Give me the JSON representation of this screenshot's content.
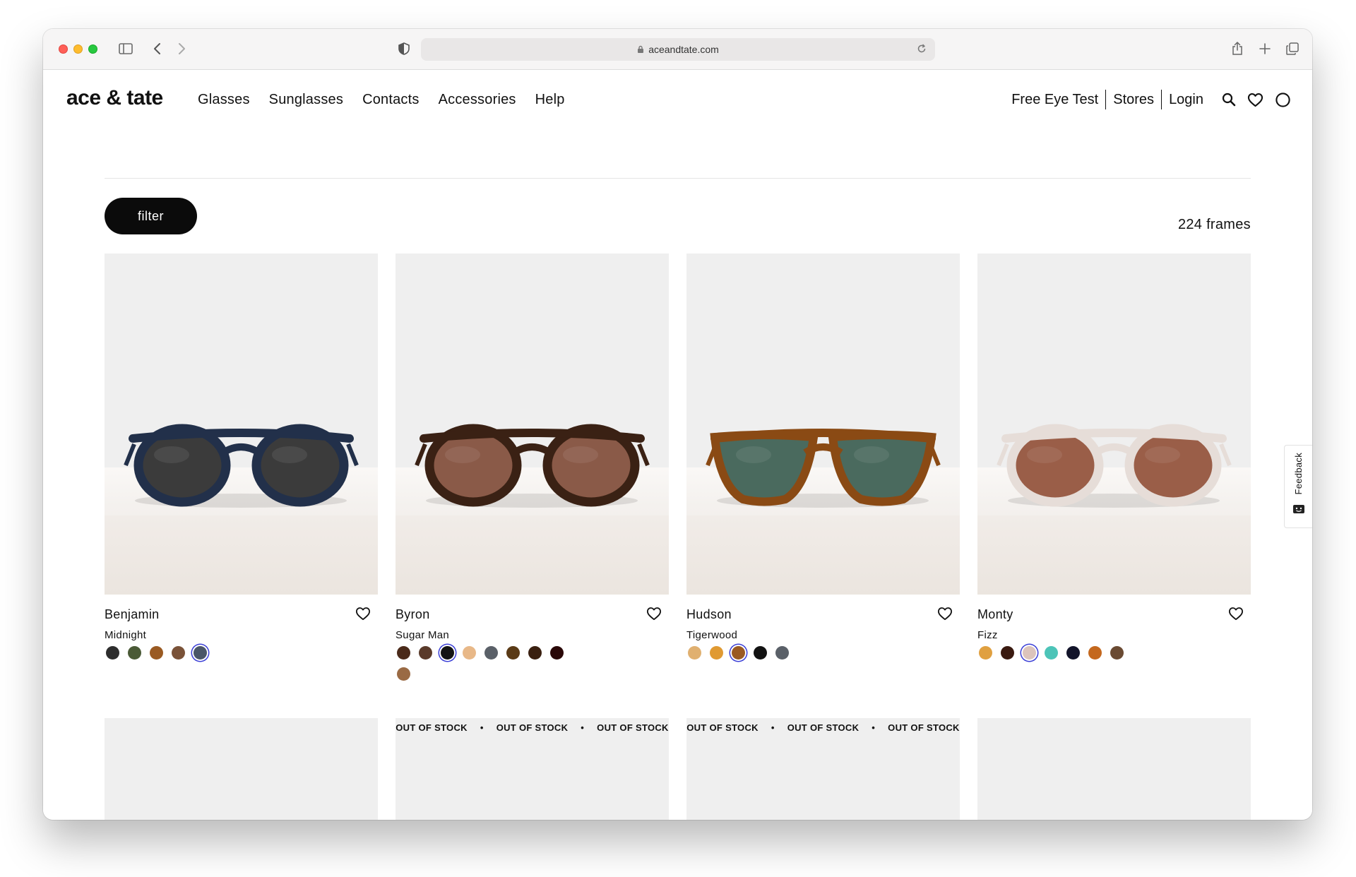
{
  "browser": {
    "url": "aceandtate.com"
  },
  "header": {
    "logo": "ace & tate",
    "nav": [
      "Glasses",
      "Sunglasses",
      "Contacts",
      "Accessories",
      "Help"
    ],
    "util_links": [
      "Free Eye Test",
      "Stores",
      "Login"
    ]
  },
  "toolbar": {
    "filter_label": "filter",
    "frame_count": "224 frames"
  },
  "products": [
    {
      "name": "Benjamin",
      "color": "Midnight",
      "frame_color": "#22304a",
      "lens_color": "#3b3b3b",
      "swatches": [
        "#2d2d2d",
        "#4a5a36",
        "#9a5a22",
        "#7a5238",
        "#4a5668"
      ],
      "selected": 4
    },
    {
      "name": "Byron",
      "color": "Sugar Man",
      "frame_color": "#3a2114",
      "lens_color": "#8a5a48",
      "swatches": [
        "#4a2a1a",
        "#5a3a2a",
        "#141414",
        "#e8b888",
        "#5a6068",
        "#5a3a16",
        "#3a2010",
        "#2a0808",
        "#9a6a44"
      ],
      "selected": 2
    },
    {
      "name": "Hudson",
      "color": "Tigerwood",
      "frame_color": "#8a4a14",
      "lens_color": "#4a6a5e",
      "swatches": [
        "#e0b070",
        "#e09a32",
        "#9a5a22",
        "#121212",
        "#5a6068"
      ],
      "selected": 2
    },
    {
      "name": "Monty",
      "color": "Fizz",
      "frame_color": "#e6ddd8",
      "lens_color": "#9a5e48",
      "swatches": [
        "#e0a040",
        "#3a1a10",
        "#dcc4bc",
        "#4cc4b8",
        "#12142a",
        "#c4681e",
        "#6a4a32"
      ],
      "selected": 2
    }
  ],
  "row2": [
    {
      "stock_labels": []
    },
    {
      "stock_labels": [
        "OUT OF STOCK",
        "OUT OF STOCK",
        "OUT OF STOCK"
      ]
    },
    {
      "stock_labels": [
        "OUT OF STOCK",
        "OUT OF STOCK",
        "OUT OF STOCK"
      ]
    },
    {
      "stock_labels": []
    }
  ],
  "feedback": {
    "label": "Feedback"
  },
  "colors": {
    "accent": "#0b0b0b",
    "swatch_selected_ring": "#3b3fd6"
  }
}
